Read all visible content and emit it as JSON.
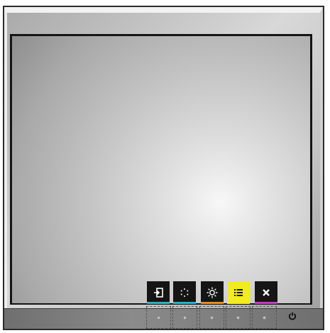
{
  "monitor": {
    "screen_state": "blank"
  },
  "osd_menu": {
    "items": [
      {
        "icon": "input-source-icon",
        "bg": "#151515",
        "underline": "#22b5c9"
      },
      {
        "icon": "color-settings-icon",
        "bg": "#151515",
        "underline": "#22b5c9"
      },
      {
        "icon": "brightness-icon",
        "bg": "#151515",
        "underline": "#f08c1a"
      },
      {
        "icon": "menu-icon",
        "bg": "#f2eb1f",
        "underline": "#f2eb1f",
        "selected": true
      },
      {
        "icon": "close-icon",
        "bg": "#151515",
        "underline": "#cc37c8"
      }
    ]
  },
  "hardware_keys": {
    "count": 5
  },
  "power": {
    "icon": "power-icon"
  }
}
